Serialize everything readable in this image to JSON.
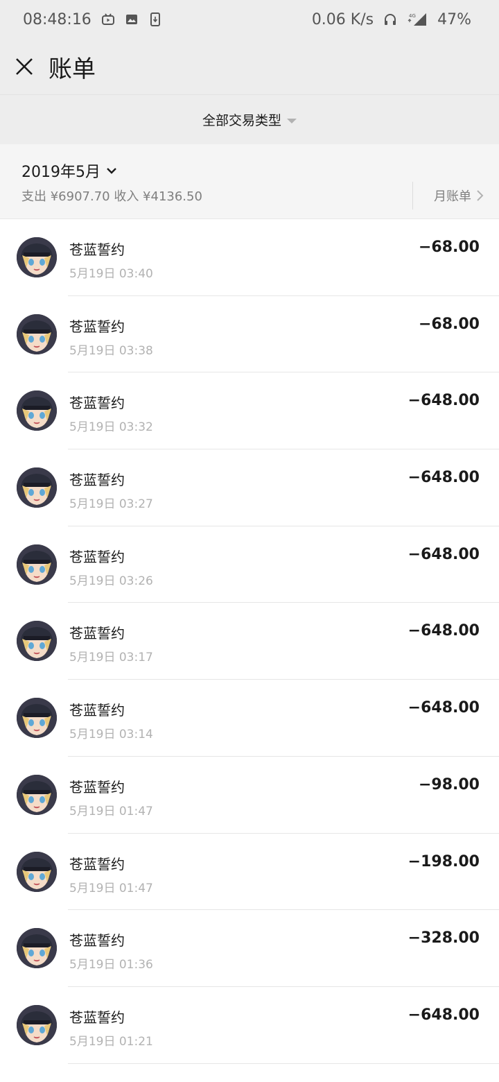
{
  "status_bar": {
    "time": "08:48:16",
    "network_speed": "0.06 K/s",
    "signal_label": "4G",
    "battery": "47%"
  },
  "header": {
    "title": "账单",
    "close_icon": "close-icon"
  },
  "filter": {
    "label": "全部交易类型"
  },
  "month": {
    "label": "2019年5月",
    "summary": "支出 ¥6907.70 收入 ¥4136.50",
    "monthly_bill_label": "月账单"
  },
  "transactions": [
    {
      "name": "苍蓝誓约",
      "time": "5月19日 03:40",
      "amount": "−68.00"
    },
    {
      "name": "苍蓝誓约",
      "time": "5月19日 03:38",
      "amount": "−68.00"
    },
    {
      "name": "苍蓝誓约",
      "time": "5月19日 03:32",
      "amount": "−648.00"
    },
    {
      "name": "苍蓝誓约",
      "time": "5月19日 03:27",
      "amount": "−648.00"
    },
    {
      "name": "苍蓝誓约",
      "time": "5月19日 03:26",
      "amount": "−648.00"
    },
    {
      "name": "苍蓝誓约",
      "time": "5月19日 03:17",
      "amount": "−648.00"
    },
    {
      "name": "苍蓝誓约",
      "time": "5月19日 03:14",
      "amount": "−648.00"
    },
    {
      "name": "苍蓝誓约",
      "time": "5月19日 01:47",
      "amount": "−98.00"
    },
    {
      "name": "苍蓝誓约",
      "time": "5月19日 01:47",
      "amount": "−198.00"
    },
    {
      "name": "苍蓝誓约",
      "time": "5月19日 01:36",
      "amount": "−328.00"
    },
    {
      "name": "苍蓝誓约",
      "time": "5月19日 01:21",
      "amount": "−648.00"
    }
  ]
}
